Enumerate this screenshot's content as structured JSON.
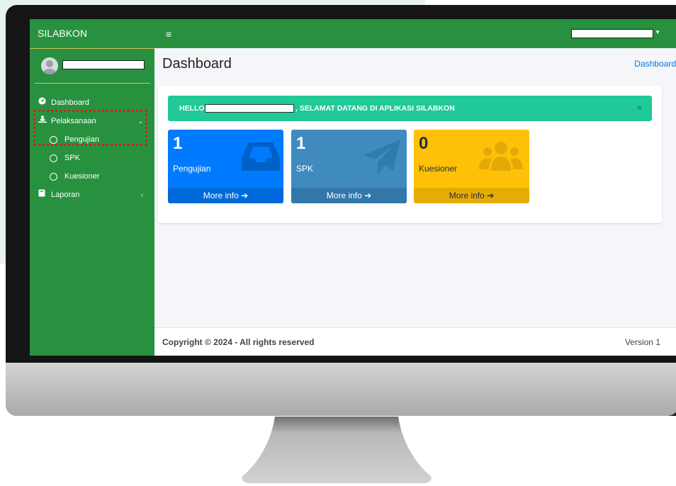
{
  "sidebar": {
    "brand": "SILABKON",
    "items": [
      {
        "label": "Dashboard",
        "icon": "dashboard-icon"
      },
      {
        "label": "Pelaksanaan",
        "icon": "person-chalkboard-icon"
      },
      {
        "label": "Pengujian",
        "icon": "circle-icon"
      },
      {
        "label": "SPK",
        "icon": "circle-icon"
      },
      {
        "label": "Kuesioner",
        "icon": "circle-icon"
      },
      {
        "label": "Laporan",
        "icon": "book-icon"
      }
    ]
  },
  "header": {
    "menu_icon": "≡"
  },
  "main": {
    "title": "Dashboard",
    "breadcrumb": "Dashboard",
    "alert": {
      "hello": "HELLO",
      "message": ", SELAMAT DATANG DI APLIKASI SILABKON",
      "close": "×"
    },
    "boxes": [
      {
        "value": "1",
        "label": "Pengujian",
        "more": "More info ➔",
        "icon": "inbox-icon"
      },
      {
        "value": "1",
        "label": "SPK",
        "more": "More info ➔",
        "icon": "paper-plane-icon"
      },
      {
        "value": "0",
        "label": "Kuesioner",
        "more": "More info ➔",
        "icon": "users-icon"
      }
    ]
  },
  "footer": {
    "copyright": "Copyright © 2024 - All rights reserved",
    "version": "Version 1"
  },
  "colors": {
    "sidebar": "#28913f",
    "alert": "#20c997",
    "box_blue": "#007bff",
    "box_steel": "#3f8bc0",
    "box_yellow": "#ffc107"
  }
}
